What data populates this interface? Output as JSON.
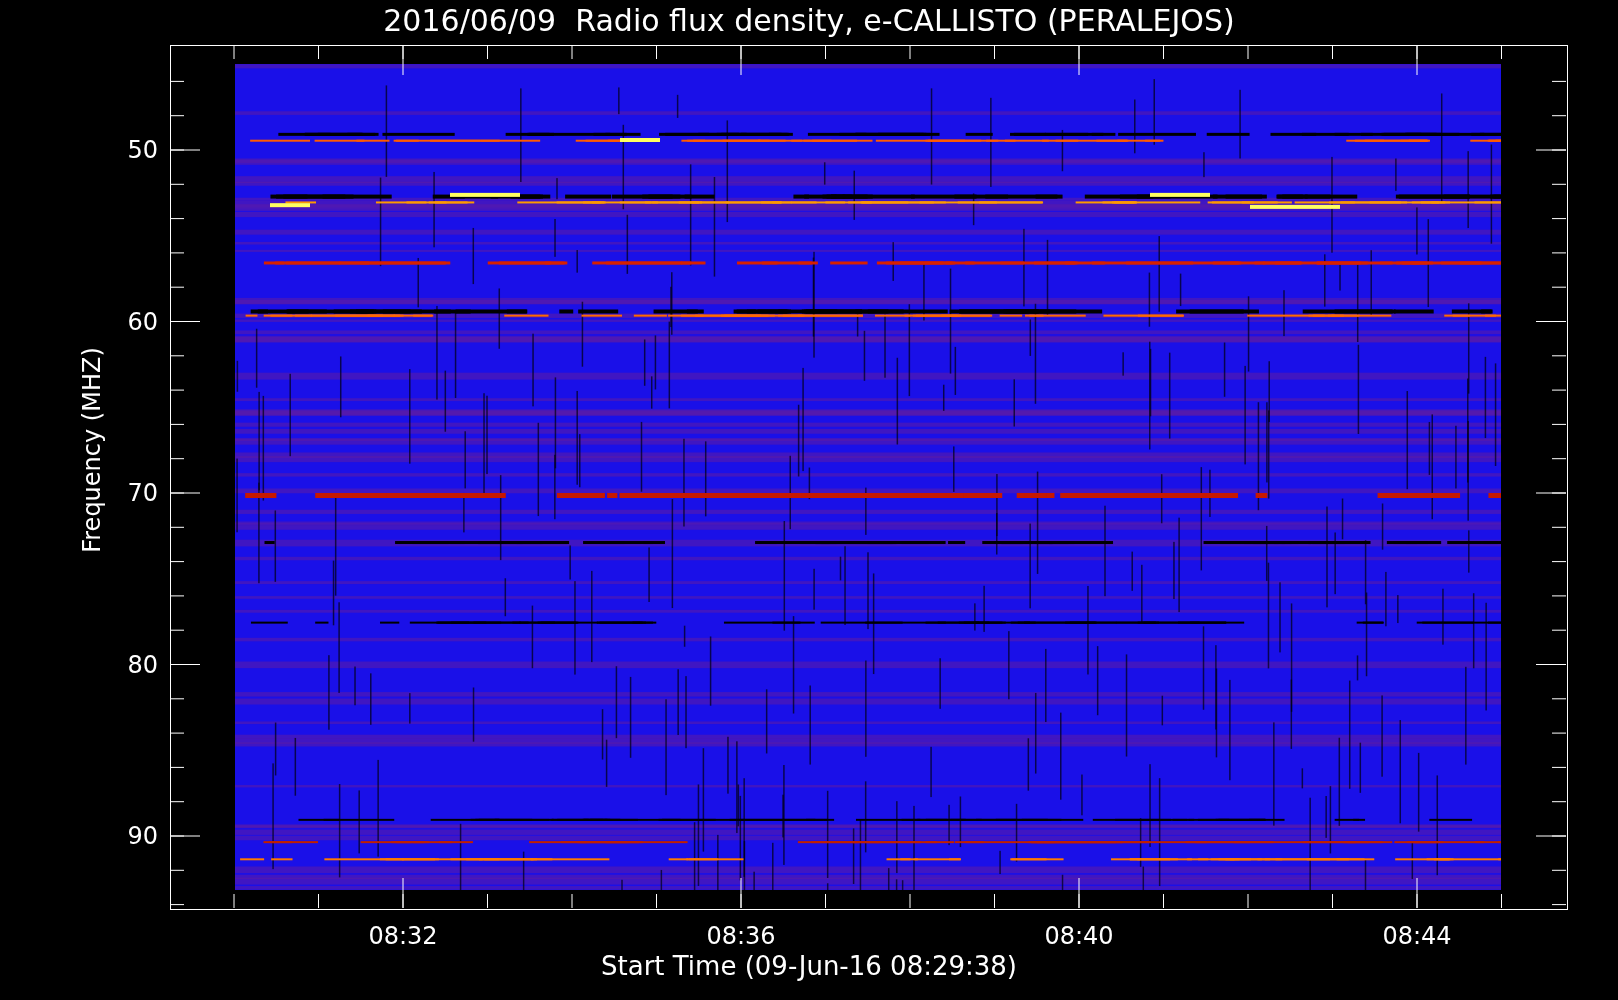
{
  "title": "2016/06/09  Radio flux density, e-CALLISTO (PERALEJOS)",
  "plot": {
    "ylabel": "Frequency (MHZ)",
    "xlabel": "Start Time (09-Jun-16 08:29:38)",
    "yticks": [
      "50",
      "60",
      "70",
      "80",
      "90"
    ],
    "xticks": [
      "08:32",
      "08:36",
      "08:40",
      "08:44"
    ]
  }
}
